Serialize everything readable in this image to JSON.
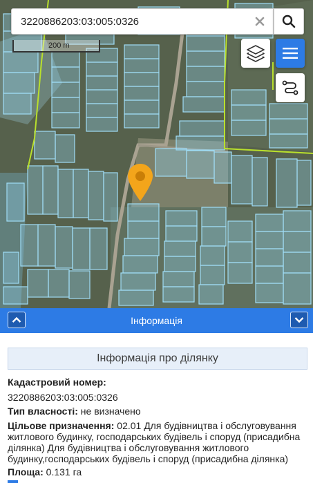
{
  "search": {
    "value": "3220886203:03:005:0326"
  },
  "scale": {
    "label": "200 m"
  },
  "info_bar": {
    "title": "Інформація"
  },
  "panel": {
    "section_title": "Інформація про ділянку",
    "cadastral_label": "Кадастровий номер:",
    "cadastral_value": "3220886203:03:005:0326",
    "ownership_label": "Тип власності:",
    "ownership_value": "не визначено",
    "purpose_label": "Цільове призначення:",
    "purpose_value": "02.01 Для будівництва і обслуговування житлового будинку, господарських будівель і споруд (присадибна ділянка) Для будівництва і обслуговування житлового будинку,господарських будівель і споруд (присадибна ділянка)",
    "area_label": "Площа:",
    "area_value": "0.131 га"
  },
  "colors": {
    "accent": "#2d7be5",
    "parcel": "#8fd0ee",
    "boundary": "#b9e02c",
    "pin": "#f3a51b"
  },
  "icons": [
    "clear-icon",
    "search-icon",
    "layers-icon",
    "menu-icon",
    "route-icon",
    "location-pin-icon",
    "chevron-up-icon",
    "chevron-down-icon"
  ]
}
